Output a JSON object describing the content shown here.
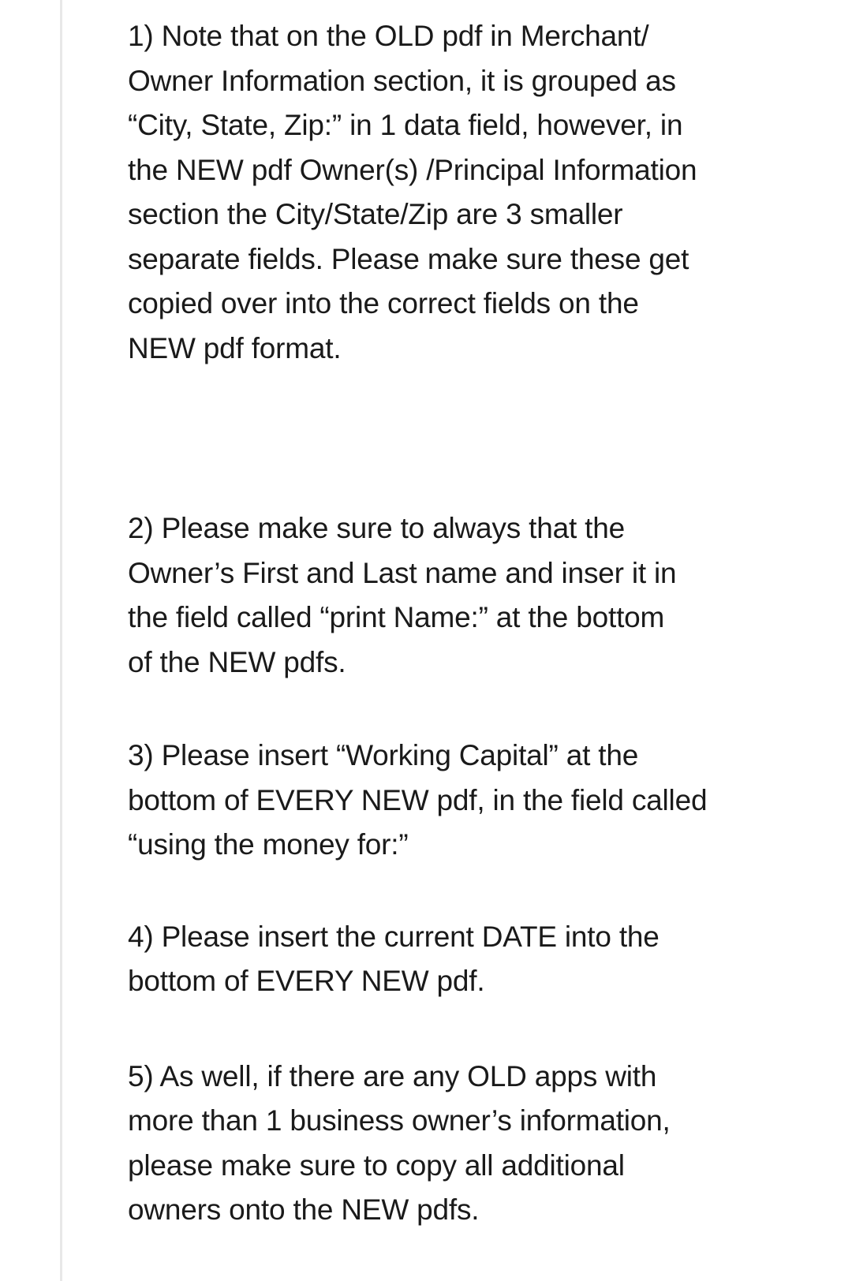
{
  "notes": [
    {
      "lines": [
        "1)  Note that on the OLD pdf in Merchant/",
        "Owner Information section, it is grouped as",
        "“City, State, Zip:” in 1 data field, however, in",
        "the NEW pdf Owner(s) /Principal Information",
        "section the City/State/Zip are 3 smaller",
        "separate fields.  Please make sure these get",
        "copied over into the correct fields on the",
        "NEW pdf format."
      ]
    },
    {
      "lines": [
        "2) Please make sure to always that the",
        "Owner’s First and Last name and inser it in",
        "the field called “print Name:” at the bottom",
        "of the NEW pdfs."
      ]
    },
    {
      "lines": [
        "3) Please insert “Working Capital” at the",
        "bottom of EVERY NEW pdf, in the field called",
        "“using the money for:”"
      ]
    },
    {
      "lines": [
        "4) Please insert the current DATE into the",
        "bottom of EVERY NEW pdf."
      ]
    },
    {
      "lines": [
        "5) As well, if there are any OLD apps with",
        "more than 1 business owner’s information,",
        "please make sure to copy all additional",
        "owners onto the NEW pdfs."
      ]
    }
  ]
}
